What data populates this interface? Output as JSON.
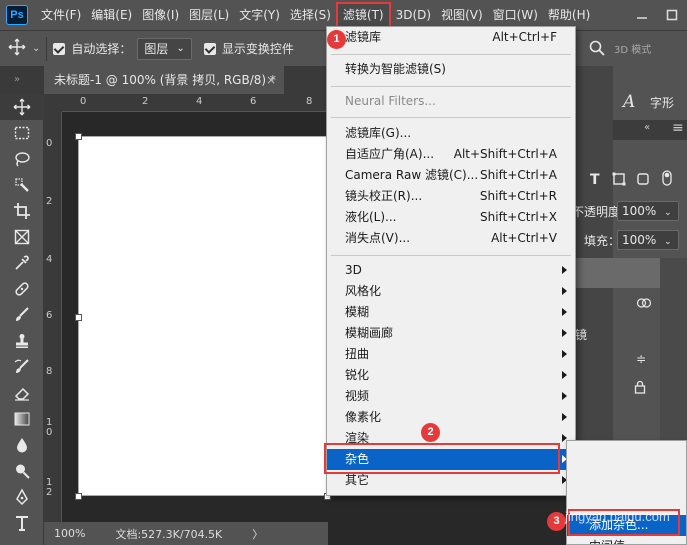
{
  "app": {
    "logo": "Ps"
  },
  "menubar": {
    "items": [
      "文件(F)",
      "编辑(E)",
      "图像(I)",
      "图层(L)",
      "文字(Y)",
      "选择(S)",
      "滤镜(T)",
      "3D(D)",
      "视图(V)",
      "窗口(W)",
      "帮助(H)"
    ],
    "active_index": 6
  },
  "options_bar": {
    "auto_select_label": "自动选择：",
    "auto_select_value": "图层",
    "show_transform_label": "显示变换控件",
    "right_label": "3D 模式"
  },
  "document_tab": {
    "title": "未标题-1 @ 100% (背景 拷贝, RGB/8) *",
    "close": "×"
  },
  "rulers": {
    "top": [
      "0",
      "2",
      "4",
      "6",
      "8"
    ],
    "left": [
      "0",
      "2",
      "4",
      "6",
      "8",
      "1\n0",
      "1\n2"
    ]
  },
  "status_bar": {
    "zoom": "100%",
    "doc_info": "文档:527.3K/704.5K",
    "arrow": "〉"
  },
  "right_panel": {
    "character_label": "字形",
    "opacity_label": "不透明度：",
    "opacity_value": "100%",
    "fill_label": "填充：",
    "fill_value": "100%",
    "layer_fragment": "镜"
  },
  "filter_menu": {
    "items": [
      {
        "label": "滤镜库",
        "shortcut": "Alt+Ctrl+F",
        "submenu": false,
        "disabled": false
      },
      {
        "label": "转换为智能滤镜(S)",
        "shortcut": "",
        "submenu": false,
        "disabled": false
      },
      {
        "label": "Neural Filters...",
        "shortcut": "",
        "submenu": false,
        "disabled": true
      },
      {
        "label": "滤镜库(G)...",
        "shortcut": "",
        "submenu": false,
        "disabled": false
      },
      {
        "label": "自适应广角(A)...",
        "shortcut": "Alt+Shift+Ctrl+A",
        "submenu": false,
        "disabled": false
      },
      {
        "label": "Camera Raw 滤镜(C)...",
        "shortcut": "Shift+Ctrl+A",
        "submenu": false,
        "disabled": false
      },
      {
        "label": "镜头校正(R)...",
        "shortcut": "Shift+Ctrl+R",
        "submenu": false,
        "disabled": false
      },
      {
        "label": "液化(L)...",
        "shortcut": "Shift+Ctrl+X",
        "submenu": false,
        "disabled": false
      },
      {
        "label": "消失点(V)...",
        "shortcut": "Alt+Ctrl+V",
        "submenu": false,
        "disabled": false
      },
      {
        "label": "3D",
        "shortcut": "",
        "submenu": true,
        "disabled": false
      },
      {
        "label": "风格化",
        "shortcut": "",
        "submenu": true,
        "disabled": false
      },
      {
        "label": "模糊",
        "shortcut": "",
        "submenu": true,
        "disabled": false
      },
      {
        "label": "模糊画廊",
        "shortcut": "",
        "submenu": true,
        "disabled": false
      },
      {
        "label": "扭曲",
        "shortcut": "",
        "submenu": true,
        "disabled": false
      },
      {
        "label": "锐化",
        "shortcut": "",
        "submenu": true,
        "disabled": false
      },
      {
        "label": "视频",
        "shortcut": "",
        "submenu": true,
        "disabled": false
      },
      {
        "label": "像素化",
        "shortcut": "",
        "submenu": true,
        "disabled": false
      },
      {
        "label": "渲染",
        "shortcut": "",
        "submenu": true,
        "disabled": false
      },
      {
        "label": "杂色",
        "shortcut": "",
        "submenu": true,
        "disabled": false
      },
      {
        "label": "其它",
        "shortcut": "",
        "submenu": true,
        "disabled": false
      }
    ],
    "highlighted_index": 18
  },
  "noise_submenu": {
    "items": [
      "添加杂色...",
      "中间值..."
    ],
    "highlighted_index": 0
  },
  "annotations": {
    "step1": "1",
    "step2": "2",
    "step3": "3"
  },
  "watermark": "jingyan.baidu.com"
}
